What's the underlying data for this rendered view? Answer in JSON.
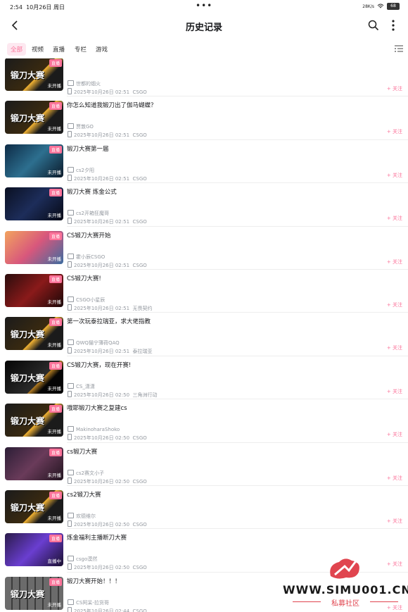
{
  "status": {
    "time": "2:54",
    "date": "10月26日 周日",
    "signal": "28K/s",
    "battery": "68"
  },
  "header": {
    "title": "历史记录"
  },
  "tabs": [
    {
      "label": "全部",
      "active": true
    },
    {
      "label": "视频"
    },
    {
      "label": "直播"
    },
    {
      "label": "专栏"
    },
    {
      "label": "游戏"
    }
  ],
  "items": [
    {
      "title": "",
      "uploader": "世都的烟火",
      "time": "2025年10月26日 02:51",
      "category": "CSGO",
      "thumb_text": "锻刀大赛",
      "theme": "dark"
    },
    {
      "title": "你怎么知道我锻刀出了伽马蝴蝶？",
      "uploader": "贾敦GO",
      "time": "2025年10月26日 02:51",
      "category": "CSGO",
      "thumb_text": "锻刀大赛",
      "theme": "dark"
    },
    {
      "title": "锻刀大赛第一届",
      "uploader": "cs2夕阳",
      "time": "2025年10月26日 02:51",
      "category": "CSGO",
      "thumb_text": "",
      "theme": "blue"
    },
    {
      "title": "锻刀大赛 炼金公式",
      "uploader": "cs2开箱狂魔哥",
      "time": "2025年10月26日 02:51",
      "category": "CSGO",
      "thumb_text": "",
      "theme": "navy"
    },
    {
      "title": "CS锻刀大赛开始",
      "uploader": "霍小辰CSGO",
      "time": "2025年10月26日 02:51",
      "category": "CSGO",
      "thumb_text": "",
      "theme": "pink"
    },
    {
      "title": "CS锻刀大赛!",
      "uploader": "CSGO小星辰",
      "time": "2025年10月26日 02:51",
      "category": "无畏契约",
      "thumb_text": "",
      "theme": "red"
    },
    {
      "title": "第一次玩泰拉瑞亚，求大佬指教",
      "uploader": "QWQ猫宁薄荷QAQ",
      "time": "2025年10月26日 02:51",
      "category": "泰拉瑞亚",
      "thumb_text": "锻刀大赛",
      "theme": "dark"
    },
    {
      "title": "CS锻刀大赛，现在开赛!",
      "uploader": "CS_潇潇",
      "time": "2025年10月26日 02:50",
      "category": "三角洲行动",
      "thumb_text": "锻刀大赛",
      "theme": "black"
    },
    {
      "title": "哦耶锻刀大赛之复建cs",
      "uploader": "MakinoharaShoko",
      "time": "2025年10月26日 02:50",
      "category": "CSGO",
      "thumb_text": "锻刀大赛",
      "theme": "dark"
    },
    {
      "title": "cs锻刀大赛",
      "uploader": "cs2赛文小子",
      "time": "2025年10月26日 02:50",
      "category": "CSGO",
      "thumb_text": "",
      "theme": "purple"
    },
    {
      "title": "cs2锻刀大赛",
      "uploader": "欢德维尔",
      "time": "2025年10月26日 02:50",
      "category": "CSGO",
      "thumb_text": "锻刀大赛",
      "theme": "dark"
    },
    {
      "title": "炼金福利主播断刀大赛",
      "uploader": "csgo漠然",
      "time": "2025年10月26日 02:50",
      "category": "CSGO",
      "thumb_text": "",
      "theme": "violet"
    },
    {
      "title": "锻刀大赛开始！！！",
      "uploader": "CS阿呆-拉货哥",
      "time": "2025年10月26日 02:44",
      "category": "CSGO",
      "thumb_text": "锻刀大赛",
      "theme": "grid"
    }
  ],
  "labels": {
    "follow": "+ 关注",
    "not_live": "未开播",
    "live": "直播中",
    "badge": "直播"
  },
  "watermark": {
    "site": "WWW.SIMU001.CN",
    "sub": "私募社区"
  },
  "colors": {
    "accent": "#fb7299",
    "muted": "#9499a0"
  }
}
